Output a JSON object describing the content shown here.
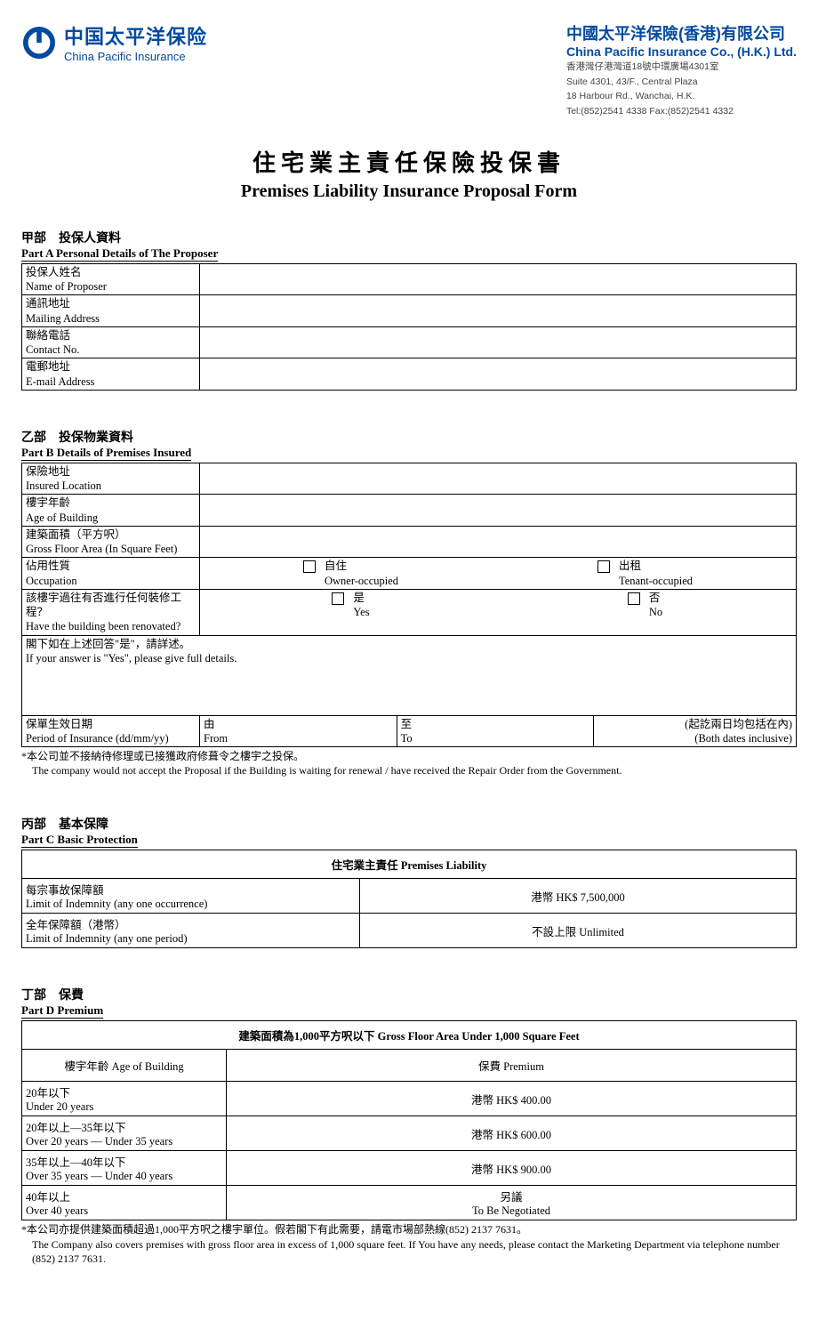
{
  "header": {
    "logo_cn": "中国太平洋保险",
    "logo_en": "China Pacific Insurance",
    "company_cn": "中國太平洋保險(香港)有限公司",
    "company_en": "China Pacific Insurance Co., (H.K.) Ltd.",
    "addr1": "香港灣仔港灣道18號中環廣場4301室",
    "addr2": "Suite 4301, 43/F., Central Plaza",
    "addr3": "18 Harbour Rd., Wanchai, H.K.",
    "tel": "Tel:(852)2541 4338  Fax:(852)2541 4332"
  },
  "title": {
    "cn": "住宅業主責任保險投保書",
    "en": "Premises Liability Insurance Proposal Form"
  },
  "partA": {
    "head_cn": "甲部　投保人資料",
    "head_en": "Part A  Personal Details of The Proposer",
    "rows": [
      {
        "cn": "投保人姓名",
        "en": "Name of Proposer"
      },
      {
        "cn": "通訊地址",
        "en": "Mailing Address"
      },
      {
        "cn": "聯絡電話",
        "en": "Contact No."
      },
      {
        "cn": "電郵地址",
        "en": "E-mail Address"
      }
    ]
  },
  "partB": {
    "head_cn": "乙部　投保物業資料",
    "head_en": "Part B  Details of Premises Insured",
    "loc_cn": "保險地址",
    "loc_en": "Insured Location",
    "age_cn": "樓宇年齡",
    "age_en": "Age of Building",
    "area_cn": "建築面積（平方呎）",
    "area_en": "Gross Floor Area (In Square Feet)",
    "occ_cn": "佔用性質",
    "occ_en": "Occupation",
    "occ_opt1_cn": "自住",
    "occ_opt1_en": "Owner-occupied",
    "occ_opt2_cn": "出租",
    "occ_opt2_en": "Tenant-occupied",
    "reno_cn": "該樓宇過往有否進行任何裝修工程？",
    "reno_en": "Have the building been renovated?",
    "yes_cn": "是",
    "yes_en": "Yes",
    "no_cn": "否",
    "no_en": "No",
    "detail_cn": "閣下如在上述回答\"是\"，請詳述。",
    "detail_en": "If your answer is \"Yes\", please give full details.",
    "period_cn": "保單生效日期",
    "period_en": "Period of Insurance (dd/mm/yy)",
    "from_cn": "由",
    "from_en": "From",
    "to_cn": "至",
    "to_en": "To",
    "both_cn": "(起訖兩日均包括在內)",
    "both_en": "(Both dates inclusive)",
    "note_cn": "*本公司並不接納待修理或已接獲政府修葺令之樓宇之投保。",
    "note_en": "The company would not accept the Proposal if the Building is waiting for renewal / have received the Repair Order from the Government."
  },
  "partC": {
    "head_cn": "丙部　基本保障",
    "head_en": "Part C  Basic Protection",
    "table_header": "住宅業主責任 Premises Liability",
    "row1_cn": "每宗事故保障額",
    "row1_en": "Limit of Indemnity (any one occurrence)",
    "row1_val": "港幣 HK$ 7,500,000",
    "row2_cn": "全年保障額（港幣）",
    "row2_en": "Limit of Indemnity (any one period)",
    "row2_val": "不設上限 Unlimited"
  },
  "partD": {
    "head_cn": "丁部　保費",
    "head_en": "Part D  Premium",
    "table_header": "建築面積為1,000平方呎以下 Gross Floor Area Under 1,000 Square Feet",
    "col1": "樓宇年齡 Age of Building",
    "col2": "保費 Premium",
    "rows": [
      {
        "age_cn": "20年以下",
        "age_en": "Under 20 years",
        "premium": "港幣 HK$ 400.00"
      },
      {
        "age_cn": "20年以上—35年以下",
        "age_en": "Over 20 years — Under 35 years",
        "premium": "港幣 HK$ 600.00"
      },
      {
        "age_cn": "35年以上—40年以下",
        "age_en": "Over 35 years — Under 40 years",
        "premium": "港幣 HK$ 900.00"
      },
      {
        "age_cn": "40年以上",
        "age_en": "Over 40 years",
        "premium_cn": "另議",
        "premium_en": "To Be Negotiated"
      }
    ],
    "note_cn": "*本公司亦提供建築面積超過1,000平方呎之樓宇單位。假若閣下有此需要，請電市場部熱線(852) 2137 7631。",
    "note_en": "The Company also covers premises with gross floor area in excess of 1,000 square feet. If You have any needs, please contact the Marketing Department via telephone number (852) 2137 7631."
  }
}
